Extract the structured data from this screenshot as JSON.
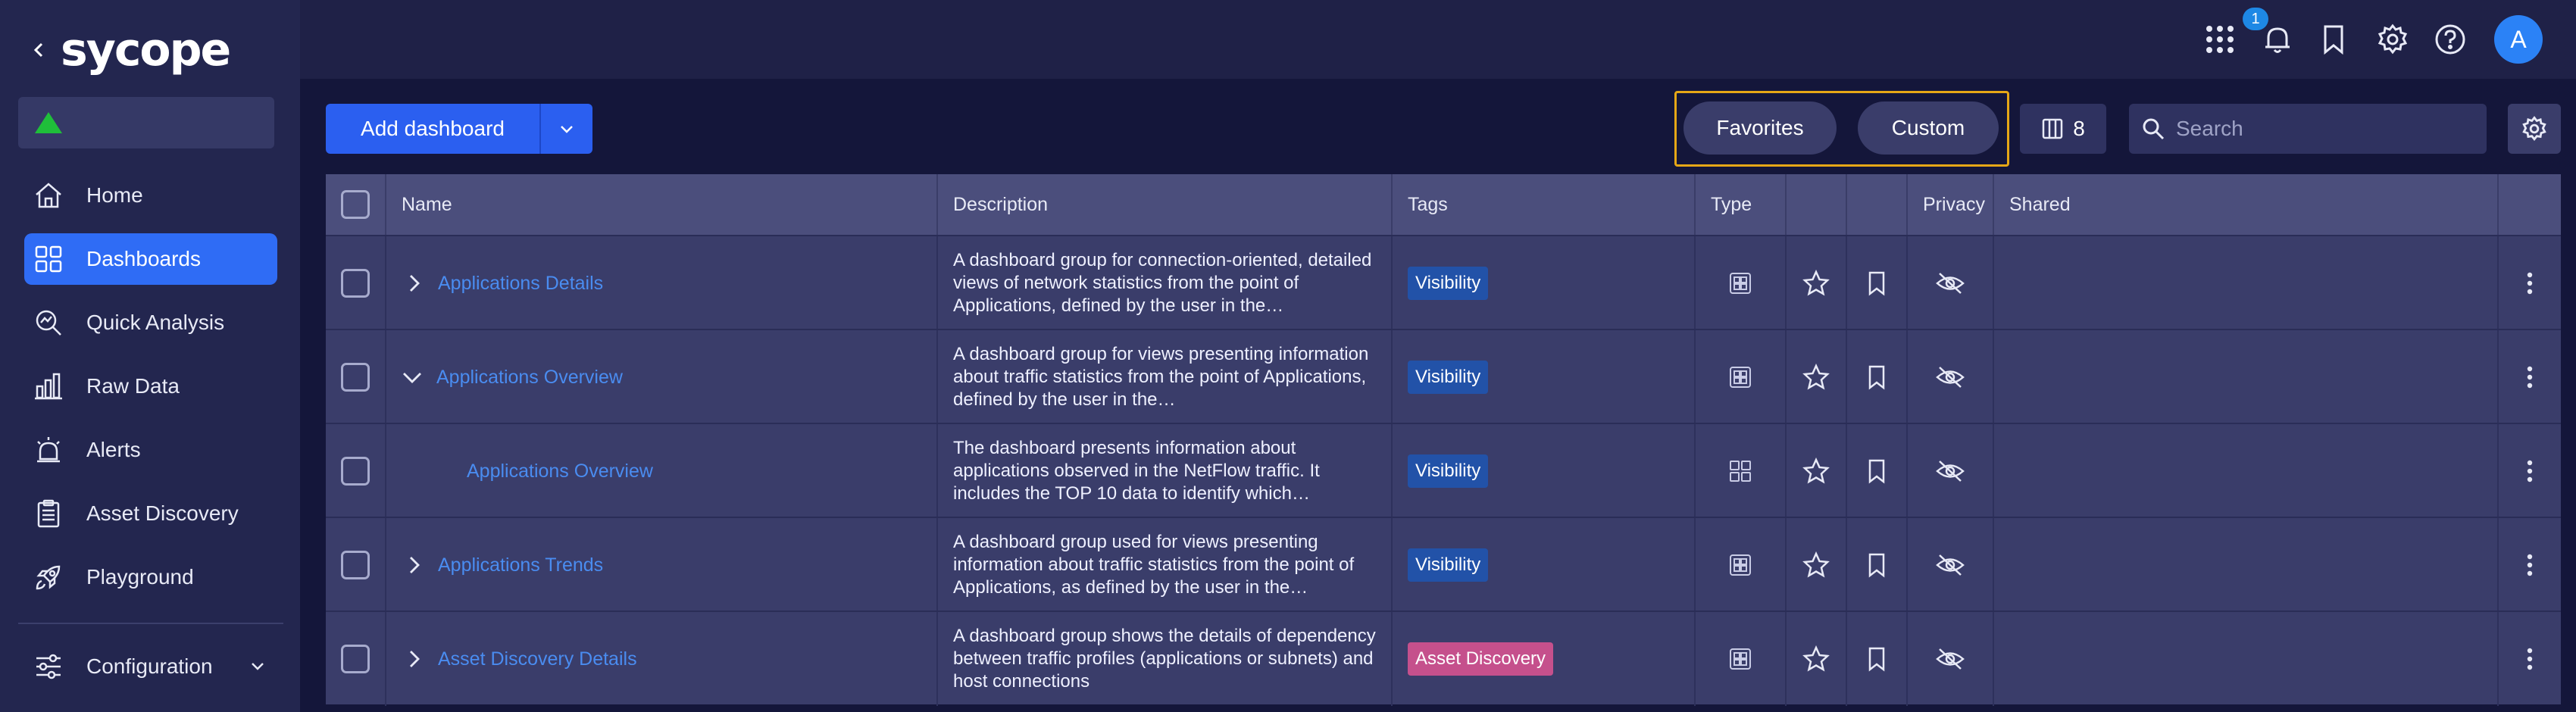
{
  "app": {
    "logo_text": "sycope"
  },
  "sidebar": {
    "items": [
      {
        "label": "Home",
        "icon": "home-icon"
      },
      {
        "label": "Dashboards",
        "icon": "dashboards-icon",
        "active": true
      },
      {
        "label": "Quick Analysis",
        "icon": "quick-analysis-icon"
      },
      {
        "label": "Raw Data",
        "icon": "bar-chart-icon"
      },
      {
        "label": "Alerts",
        "icon": "alarm-icon"
      },
      {
        "label": "Asset Discovery",
        "icon": "clipboard-icon"
      },
      {
        "label": "Playground",
        "icon": "rocket-icon"
      }
    ],
    "configuration_label": "Configuration"
  },
  "topbar": {
    "notification_count": "1",
    "avatar_letter": "A"
  },
  "toolbar": {
    "add_dashboard_label": "Add dashboard",
    "favorites_label": "Favorites",
    "custom_label": "Custom",
    "column_count": "8",
    "search_placeholder": "Search"
  },
  "table": {
    "columns": [
      "Name",
      "Description",
      "Tags",
      "Type",
      "Privacy",
      "Shared"
    ],
    "rows": [
      {
        "expander": "collapsed",
        "name": "Applications Details",
        "description": "A dashboard group for connection-oriented, detailed views of network statistics from the point of Applications, defined by the user in the…",
        "tag": "Visibility",
        "tag_color": "#2252a8",
        "type_icon": "dashboard-group-icon"
      },
      {
        "expander": "expanded",
        "name": "Applications Overview",
        "description": "A dashboard group for views presenting information about traffic statistics from the point of Applications, defined by the user in the…",
        "tag": "Visibility",
        "tag_color": "#2252a8",
        "type_icon": "dashboard-group-icon"
      },
      {
        "expander": "none",
        "name": "Applications Overview",
        "description": "The dashboard presents information about applications observed in the NetFlow traffic. It includes the TOP 10 data to identify which…",
        "tag": "Visibility",
        "tag_color": "#2252a8",
        "type_icon": "dashboard-icon"
      },
      {
        "expander": "collapsed",
        "name": "Applications Trends",
        "description": "A dashboard group used for views presenting information about traffic statistics from the point of Applications, as defined by the user in the…",
        "tag": "Visibility",
        "tag_color": "#2252a8",
        "type_icon": "dashboard-group-icon"
      },
      {
        "expander": "collapsed",
        "name": "Asset Discovery Details",
        "description": "A dashboard group shows the details of dependency between traffic profiles (applications or subnets) and host connections",
        "tag": "Asset Discovery",
        "tag_color": "#c5508c",
        "type_icon": "dashboard-group-icon"
      }
    ]
  },
  "colors": {
    "accent": "#2f6cf5",
    "highlight_border": "#e6a716",
    "status_ok": "#1fbf3a"
  }
}
